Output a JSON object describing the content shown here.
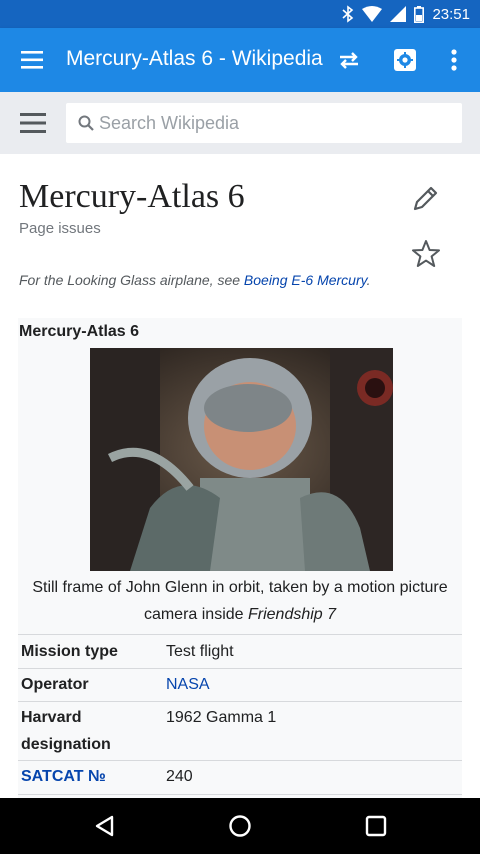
{
  "status_bar": {
    "time": "23:51"
  },
  "app_bar": {
    "title": "Mercury-Atlas 6 - Wikipedia"
  },
  "search": {
    "placeholder": "Search Wikipedia"
  },
  "article": {
    "title": "Mercury-Atlas 6",
    "page_issues": "Page issues",
    "hatnote_prefix": "For the Looking Glass airplane, see ",
    "hatnote_link": "Boeing E-6 Mercury",
    "hatnote_suffix": "."
  },
  "infobox": {
    "title": "Mercury-Atlas 6",
    "caption_main": "Still frame of John Glenn in orbit, taken by a motion picture camera inside ",
    "caption_italic": "Friendship 7",
    "rows": [
      {
        "label": "Mission type",
        "value": "Test flight"
      },
      {
        "label": "Operator",
        "value": "NASA"
      },
      {
        "label": "Harvard designation",
        "value": "1962 Gamma 1"
      },
      {
        "label": "SATCAT №",
        "value": "240"
      }
    ]
  },
  "colors": {
    "status_bar": "#1565c0",
    "app_bar": "#1e88e5",
    "link": "#0645ad"
  }
}
